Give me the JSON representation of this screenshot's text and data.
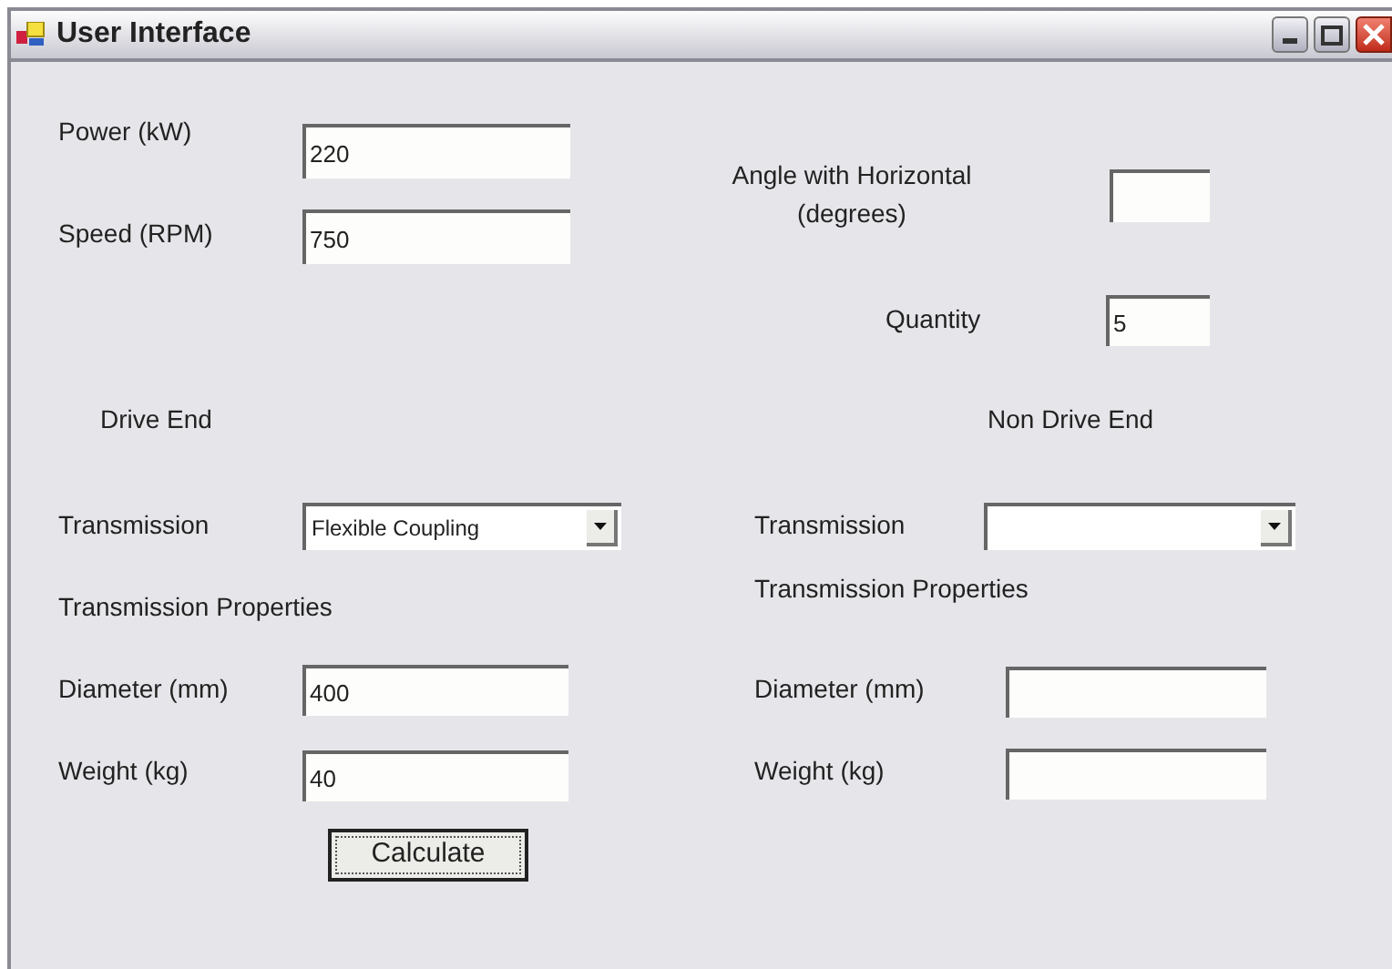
{
  "window": {
    "title": "User Interface"
  },
  "top_fields": [
    {
      "label": "Power (kW)",
      "value": "220"
    },
    {
      "label": "Speed (RPM)",
      "value": "750"
    }
  ],
  "angle": {
    "label_lines": [
      "Angle with Horizontal",
      "(degrees)"
    ]
  },
  "quantity": {
    "label": "Quantity",
    "value": "5"
  },
  "sections": [
    {
      "heading": "Drive End",
      "transmission_label": "Transmission",
      "transmission_value": "Flexible Coupling",
      "properties_heading": "Transmission Properties",
      "fields": [
        {
          "label": "Diameter (mm)",
          "value": "400"
        },
        {
          "label": "Weight (kg)",
          "value": "40"
        }
      ]
    },
    {
      "heading": "Non Drive End",
      "transmission_label": "Transmission",
      "properties_heading": "Transmission Properties",
      "fields": [
        {
          "label": "Diameter (mm)"
        },
        {
          "label": "Weight (kg)"
        }
      ]
    }
  ],
  "buttons": [
    "Calculate"
  ]
}
